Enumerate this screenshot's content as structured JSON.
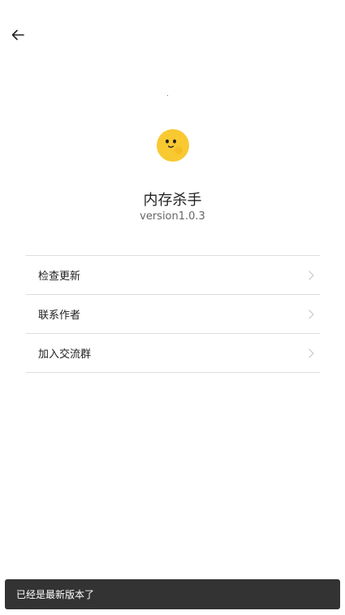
{
  "header": {
    "back_icon": "arrow-left-icon"
  },
  "app": {
    "logo_icon": "yellow-face-logo",
    "name": "内存杀手",
    "version": "version1.0.3"
  },
  "menu": {
    "items": [
      {
        "label": "检查更新",
        "icon": "chevron-right-icon"
      },
      {
        "label": "联系作者",
        "icon": "chevron-right-icon"
      },
      {
        "label": "加入交流群",
        "icon": "chevron-right-icon"
      }
    ]
  },
  "toast": {
    "text": "已经是最新版本了"
  },
  "colors": {
    "background": "#ffffff",
    "divider": "#dcdcdc",
    "logo": "#f8c931",
    "toast_bg": "#333333"
  }
}
